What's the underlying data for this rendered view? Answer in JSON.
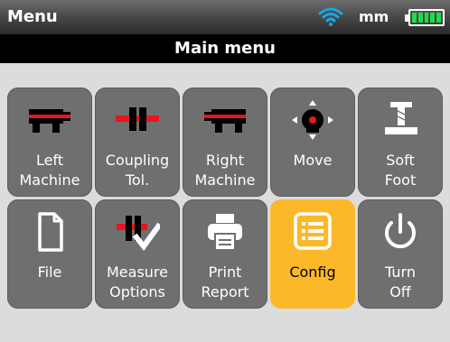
{
  "status_bar": {
    "title": "Menu",
    "unit": "mm",
    "battery_level": 1.0
  },
  "header": {
    "title": "Main menu"
  },
  "menu": {
    "tiles": [
      {
        "line1": "Left",
        "line2": "Machine",
        "icon": "left-machine-icon"
      },
      {
        "line1": "Coupling",
        "line2": "Tol.",
        "icon": "coupling-icon"
      },
      {
        "line1": "Right",
        "line2": "Machine",
        "icon": "right-machine-icon"
      },
      {
        "line1": "Move",
        "line2": "",
        "icon": "move-icon"
      },
      {
        "line1": "Soft",
        "line2": "Foot",
        "icon": "soft-foot-icon"
      },
      {
        "line1": "File",
        "line2": "",
        "icon": "file-icon"
      },
      {
        "line1": "Measure",
        "line2": "Options",
        "icon": "measure-options-icon"
      },
      {
        "line1": "Print",
        "line2": "Report",
        "icon": "printer-icon"
      },
      {
        "line1": "Config",
        "line2": "",
        "icon": "config-list-icon",
        "selected": true
      },
      {
        "line1": "Turn",
        "line2": "Off",
        "icon": "power-icon"
      }
    ]
  },
  "colors": {
    "tile": "#6f6f6f",
    "selected_tile": "#fbb929",
    "accent_red": "#e8141e",
    "wifi": "#1aa6e8",
    "battery": "#19e04a"
  }
}
